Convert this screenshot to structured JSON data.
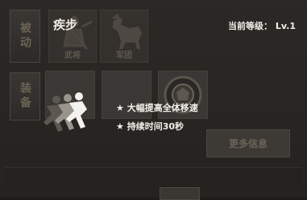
{
  "tabs": {
    "passive_label": "被动",
    "equip_label": "装备"
  },
  "skill": {
    "name": "疾步",
    "level_text": "当前等级： Lv.1",
    "icon": "running-figures-icon",
    "description": [
      "★ 大幅提高全体移速",
      "★ 持续时间30秒"
    ]
  },
  "passive_slots": [
    {
      "label": "武将",
      "icon": "general-warrior-icon"
    },
    {
      "label": "军团",
      "icon": "cavalry-horse-icon"
    }
  ],
  "equipment_slots": [
    {
      "icon": "empty-slot"
    },
    {
      "icon": "empty-slot"
    },
    {
      "icon": "empty-slot"
    },
    {
      "icon": "armor-icon"
    }
  ],
  "buttons": {
    "more_info": "更多信息"
  }
}
